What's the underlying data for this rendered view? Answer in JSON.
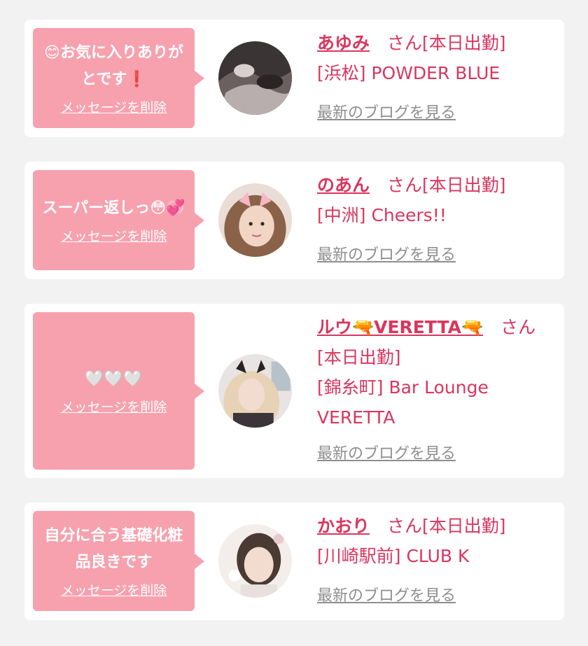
{
  "cards": [
    {
      "message": "😊お気に入りありがとです❗",
      "delete_label": "メッセージを削除",
      "name": "あゆみ",
      "san": "　さん",
      "status": "[本日出勤]",
      "shop": "[浜松] POWDER BLUE",
      "blog_label": "最新のブログを見る"
    },
    {
      "message": "スーパー返しっ😳💞",
      "delete_label": "メッセージを削除",
      "name": "のあん",
      "san": "　さん",
      "status": "[本日出勤]",
      "shop": "[中洲] Cheers!!",
      "blog_label": "最新のブログを見る"
    },
    {
      "message": "🤍🤍🤍",
      "delete_label": "メッセージを削除",
      "name": "ルウ🔫VERETTA🔫",
      "san": "　さん",
      "status": "[本日出勤]",
      "shop": "[錦糸町] Bar Lounge VERETTA",
      "blog_label": "最新のブログを見る"
    },
    {
      "message": "自分に合う基礎化粧品良きです",
      "delete_label": "メッセージを削除",
      "name": "かおり",
      "san": "　さん",
      "status": "[本日出勤]",
      "shop": "[川崎駅前] CLUB K",
      "blog_label": "最新のブログを見る"
    }
  ],
  "colors": {
    "accent": "#d9365e",
    "bubble": "#f7a1ae",
    "link_gray": "#8e8e8e",
    "background": "#f2f2f2"
  }
}
